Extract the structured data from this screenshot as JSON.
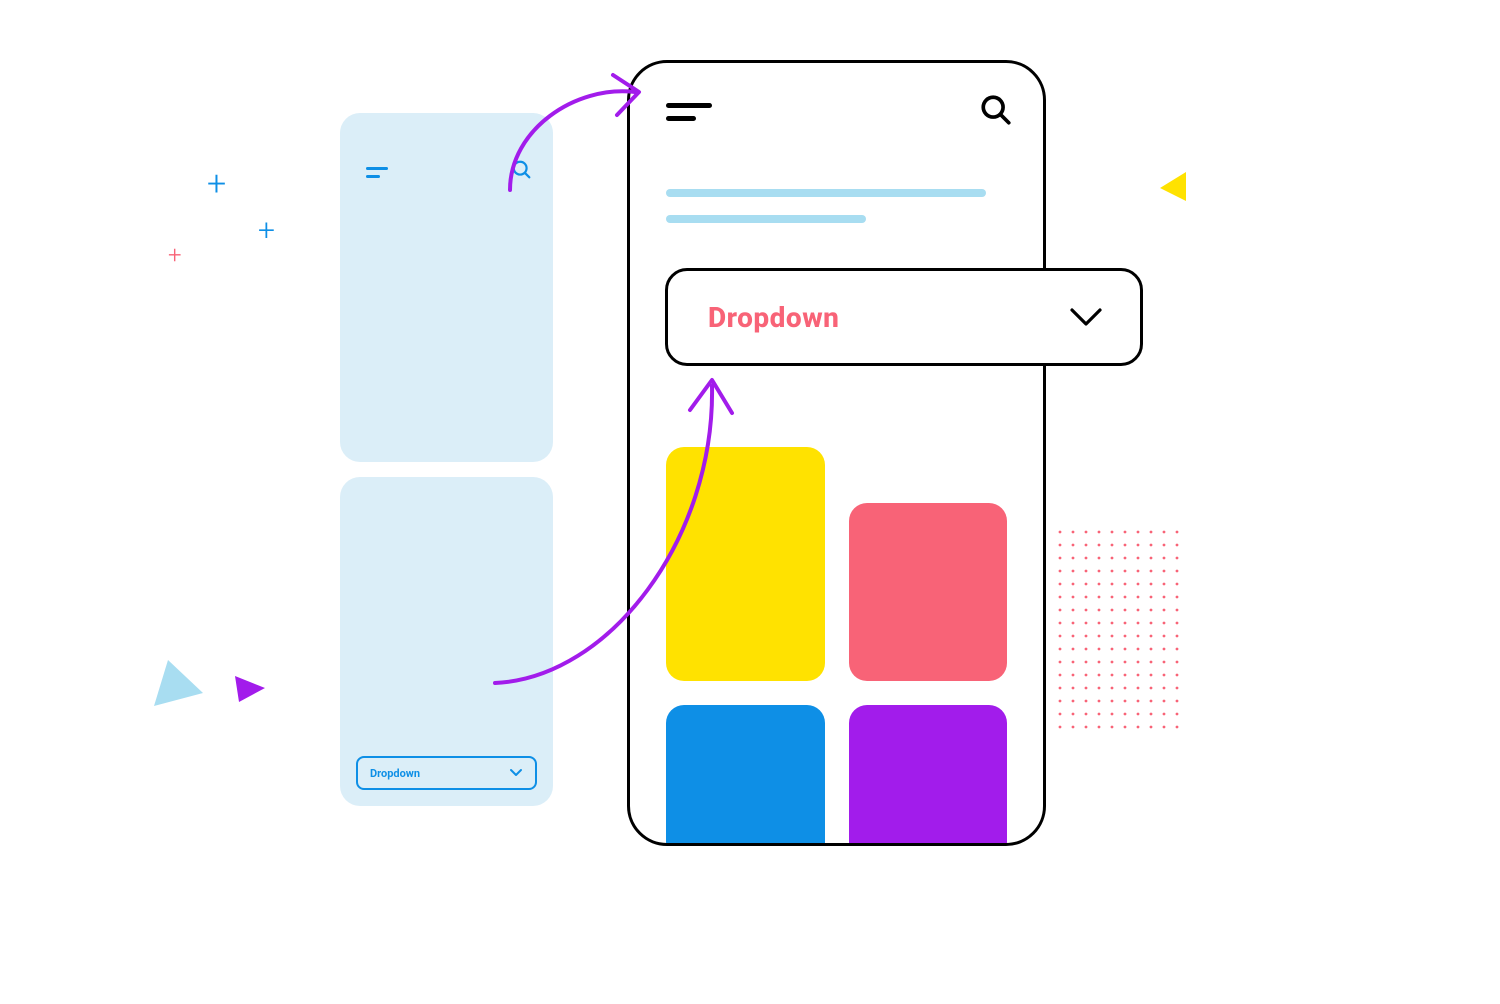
{
  "small_phone": {
    "dropdown_label": "Dropdown"
  },
  "large_phone": {
    "dropdown_label": "Dropdown"
  },
  "tiles": {
    "yellow": "#FFE200",
    "pink": "#F86377",
    "blue": "#0E8FE6",
    "purple": "#A21CEB"
  }
}
